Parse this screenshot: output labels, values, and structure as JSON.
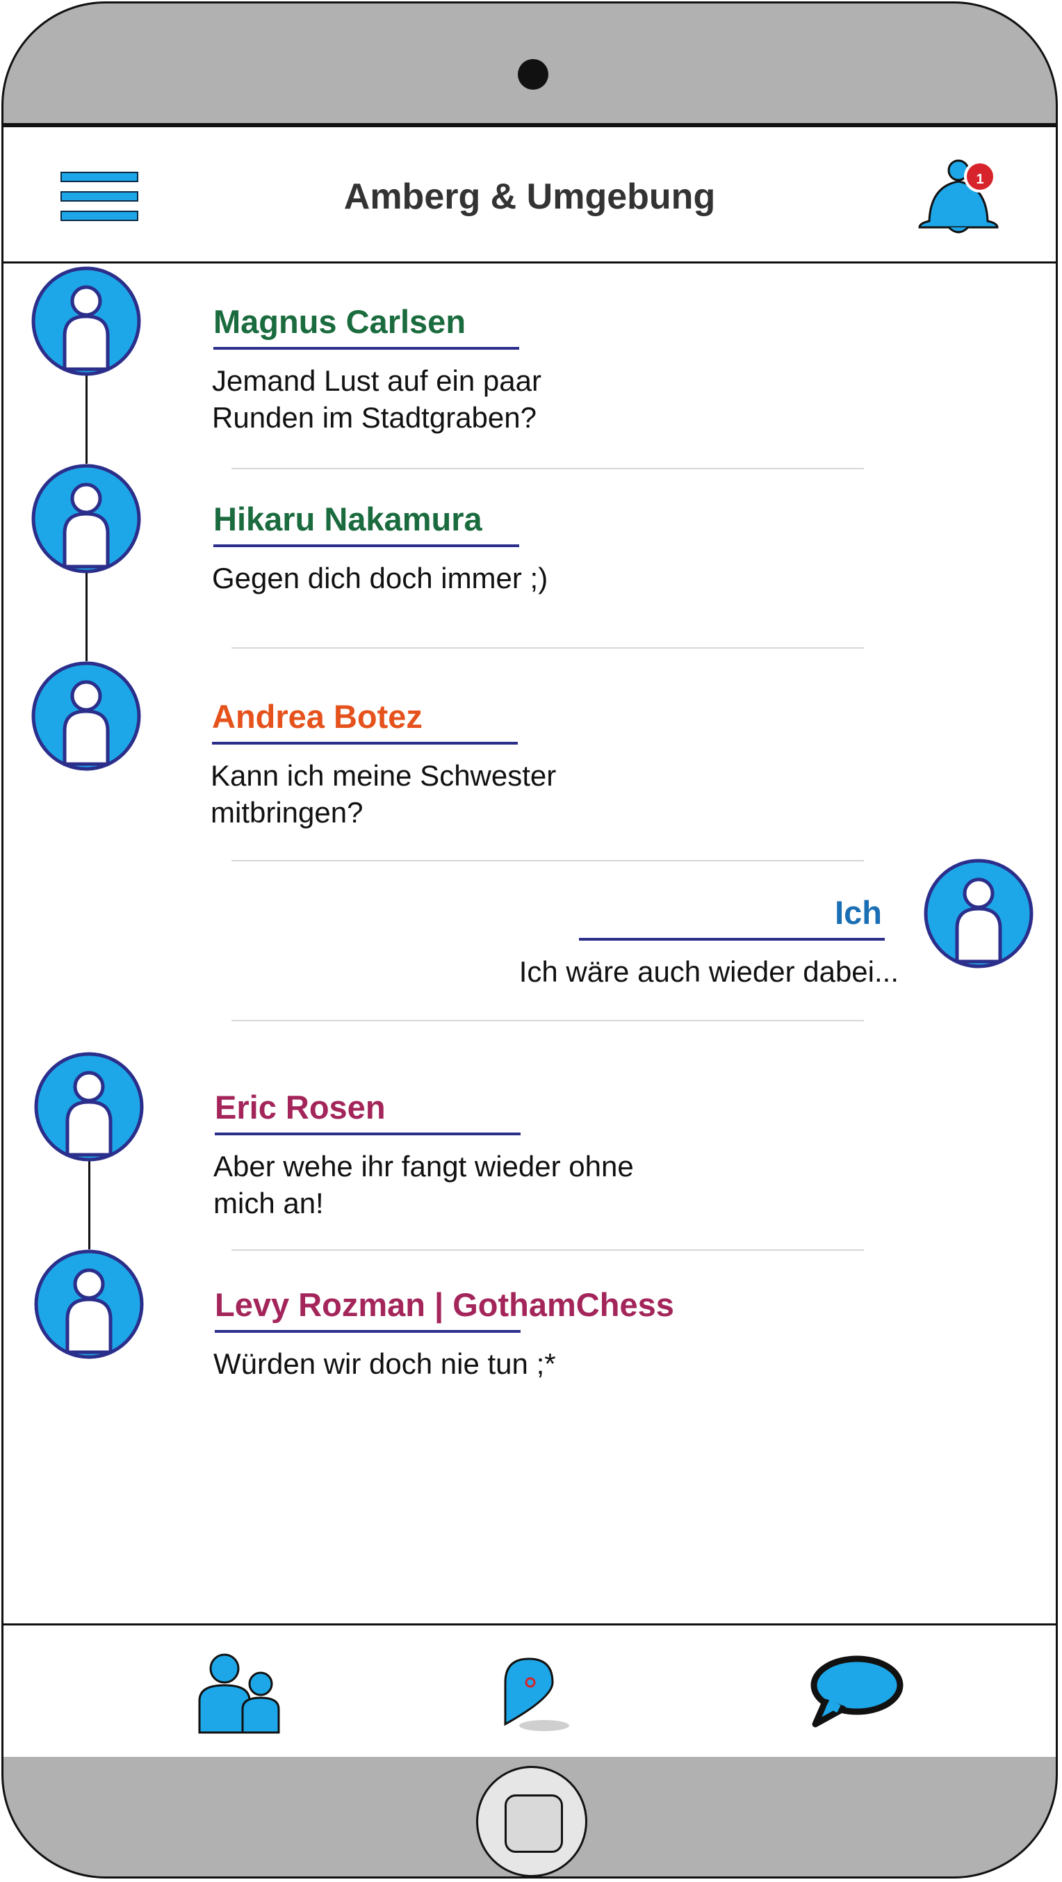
{
  "header": {
    "title": "Amberg & Umgebung",
    "notification_count": "1"
  },
  "colors": {
    "accent": "#1ea7e8",
    "name_green": "#1a6b3e",
    "name_orange": "#e5521c",
    "name_blue": "#1a6fb4",
    "name_magenta": "#a3255a",
    "underline": "#2b2e8a"
  },
  "messages": [
    {
      "name": "Magnus Carlsen",
      "text": [
        "Jemand Lust auf ein paar",
        "Runden im Stadtgraben?"
      ],
      "color": "#1a6b3e",
      "side": "left"
    },
    {
      "name": "Hikaru Nakamura",
      "text": [
        "Gegen dich doch immer ;)"
      ],
      "color": "#1a6b3e",
      "side": "left"
    },
    {
      "name": "Andrea Botez",
      "text": [
        "Kann ich meine Schwester",
        "mitbringen?"
      ],
      "color": "#e5521c",
      "side": "left"
    },
    {
      "name": "Ich",
      "text": [
        "Ich wäre auch wieder dabei..."
      ],
      "color": "#1a6fb4",
      "side": "right"
    },
    {
      "name": "Eric Rosen",
      "text": [
        "Aber wehe ihr fangt wieder ohne",
        "mich an!"
      ],
      "color": "#a3255a",
      "side": "left"
    },
    {
      "name": "Levy Rozman | GothamChess",
      "text": [
        "Würden wir doch nie tun ;*"
      ],
      "color": "#a3255a",
      "side": "left"
    }
  ],
  "tabs": [
    {
      "icon": "users-icon"
    },
    {
      "icon": "map-pin-icon"
    },
    {
      "icon": "chat-bubble-icon"
    }
  ]
}
